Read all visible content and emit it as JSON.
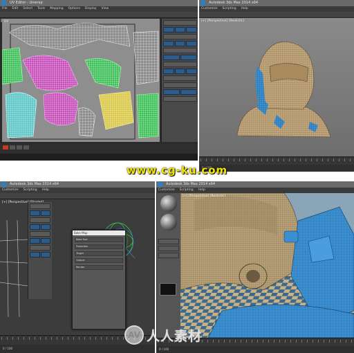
{
  "watermark_top": "www.cg-ku.com",
  "watermark_bottom": {
    "logo_letters": "AV",
    "text": "人人素材"
  },
  "panels": [
    {
      "id": "top-left",
      "title": "UV Editor - Unwrap",
      "menu": [
        "File",
        "Edit",
        "Select",
        "Tools",
        "Mapping",
        "Options",
        "Display",
        "View"
      ],
      "viewport_label": "UV",
      "status": "0 / 100"
    },
    {
      "id": "top-right",
      "title": "Autodesk 3ds Max 2014 x64",
      "menu": [
        "Customize",
        "Scripting",
        "Help"
      ],
      "viewport_label": "[+] [Perspective] [Realistic]",
      "status": "0 / 100"
    },
    {
      "id": "bottom-left",
      "title": "Autodesk 3ds Max 2014 x64",
      "menu": [
        "Customize",
        "Scripting",
        "Help"
      ],
      "viewport_label": "[+] [Perspective] [Shaded]",
      "dialog": {
        "title": "Bake Map",
        "rows": [
          "Bake Tool",
          "Projection",
          "Target",
          "Output",
          "Render"
        ]
      },
      "status": "0 / 100"
    },
    {
      "id": "bottom-right",
      "title": "Autodesk 3ds Max 2014 x64",
      "menu": [
        "Customize",
        "Scripting",
        "Help"
      ],
      "viewport_label": "[+] [Perspective] [Realistic]",
      "status": "0 / 100"
    }
  ],
  "colors": {
    "uv_background": "#8e8e8e",
    "model_tan": "#c2a77c",
    "model_blue": "#3b8fd0",
    "checker_a": "#3c6a8c",
    "checker_b": "#c9b187",
    "watermark": "#f2e600"
  }
}
